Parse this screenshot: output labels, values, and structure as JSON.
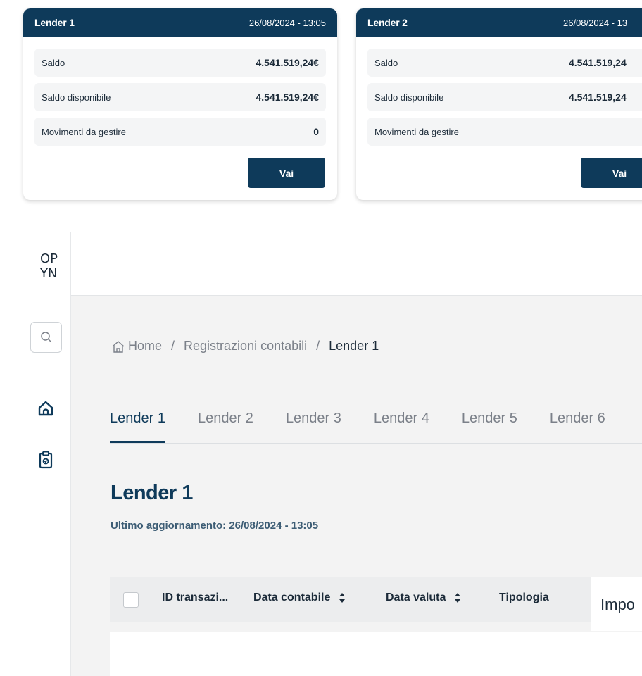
{
  "cards": [
    {
      "name": "Lender 1",
      "date": "26/08/2024 - 13:05",
      "rows": [
        {
          "label": "Saldo",
          "value": "4.541.519,24€"
        },
        {
          "label": "Saldo disponibile",
          "value": "4.541.519,24€"
        },
        {
          "label": "Movimenti da gestire",
          "value": "0"
        }
      ],
      "button": "Vai"
    },
    {
      "name": "Lender 2",
      "date": "26/08/2024 - 13",
      "rows": [
        {
          "label": "Saldo",
          "value": "4.541.519,24"
        },
        {
          "label": "Saldo disponibile",
          "value": "4.541.519,24"
        },
        {
          "label": "Movimenti da gestire",
          "value": ""
        }
      ],
      "button": "Vai"
    }
  ],
  "sidebar": {
    "logo_top": "OP",
    "logo_bottom": "YN",
    "icons": [
      "search-icon",
      "home-icon",
      "clipboard-icon"
    ]
  },
  "breadcrumb": {
    "home": "Home",
    "section": "Registrazioni contabili",
    "current": "Lender 1",
    "separator": "/"
  },
  "tabs": [
    {
      "label": "Lender 1",
      "active": true
    },
    {
      "label": "Lender 2",
      "active": false
    },
    {
      "label": "Lender 3",
      "active": false
    },
    {
      "label": "Lender 4",
      "active": false
    },
    {
      "label": "Lender 5",
      "active": false
    },
    {
      "label": "Lender 6",
      "active": false
    }
  ],
  "page": {
    "title": "Lender 1",
    "updated": "Ultimo aggiornamento: 26/08/2024 - 13:05"
  },
  "table": {
    "columns": {
      "id": "ID transazi...",
      "data_contabile": "Data contabile",
      "data_valuta": "Data valuta",
      "tipologia": "Tipologia",
      "importo": "Impo"
    }
  },
  "colors": {
    "primary": "#0e3a5a",
    "background": "#f3f3f3",
    "muted_text": "#7b8089"
  }
}
